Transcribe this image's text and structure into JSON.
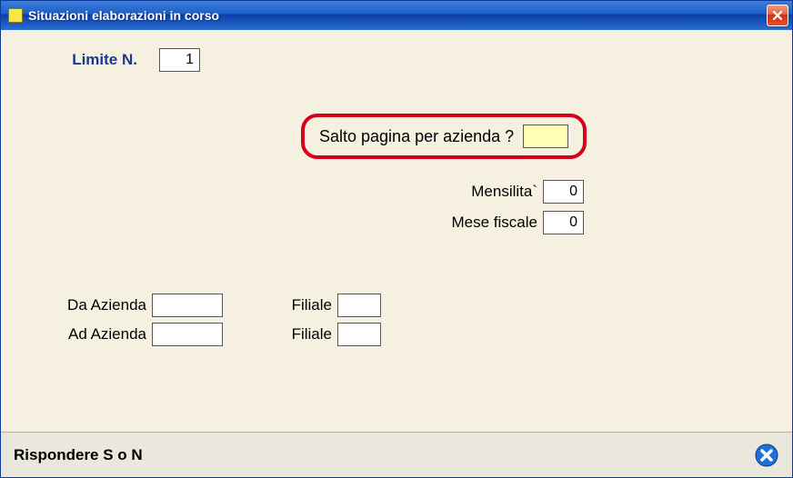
{
  "window": {
    "title": "Situazioni elaborazioni in corso"
  },
  "limite": {
    "label": "Limite N.",
    "value": "1"
  },
  "salto": {
    "label": "Salto pagina per azienda ?",
    "value": ""
  },
  "mensilita": {
    "label": "Mensilita`",
    "value": "0"
  },
  "mese_fiscale": {
    "label": "Mese fiscale",
    "value": "0"
  },
  "da_azienda": {
    "label": "Da Azienda",
    "value": ""
  },
  "ad_azienda": {
    "label": "Ad Azienda",
    "value": ""
  },
  "filiale1": {
    "label": "Filiale",
    "value": ""
  },
  "filiale2": {
    "label": "Filiale",
    "value": ""
  },
  "status": {
    "text": "Rispondere S o N"
  }
}
